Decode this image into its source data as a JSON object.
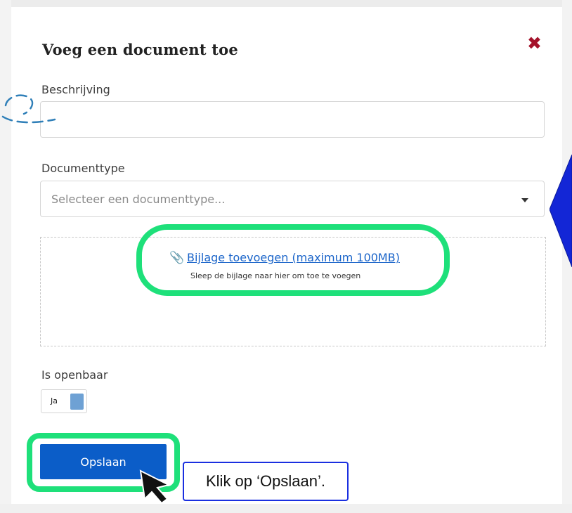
{
  "modal": {
    "title": "Voeg een document toe",
    "close_icon": "close-icon"
  },
  "form": {
    "description_label": "Beschrijving",
    "description_value": "",
    "doctype_label": "Documenttype",
    "doctype_placeholder": "Selecteer een documenttype...",
    "attach_link": "Bijlage toevoegen (maximum 100MB)",
    "drop_hint": "Sleep de bijlage naar hier om toe te voegen",
    "public_label": "Is openbaar",
    "public_toggle_label": "Ja"
  },
  "actions": {
    "save_label": "Opslaan"
  },
  "annotation": {
    "callout_text": "Klik op ‘Opslaan’."
  },
  "colors": {
    "close": "#a4122a",
    "primary": "#0b5dc8",
    "link": "#1a64c9",
    "highlight": "#1ee07a",
    "callout_border": "#1a2fe0",
    "side_arrow": "#1326d6"
  }
}
